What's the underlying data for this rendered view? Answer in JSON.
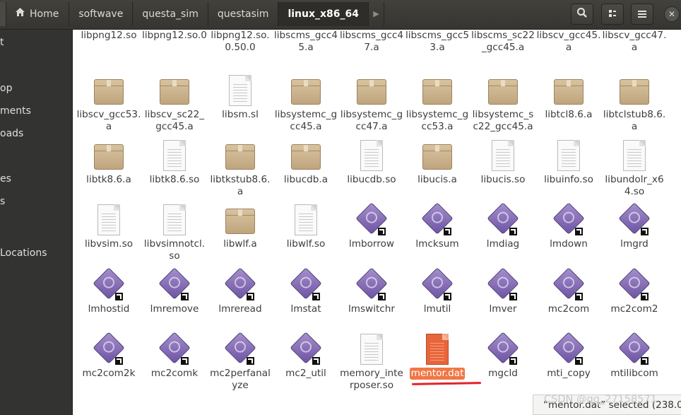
{
  "breadcrumbs": [
    "Home",
    "softwave",
    "questa_sim",
    "questasim",
    "linux_x86_64"
  ],
  "sidebar": [
    "t",
    "op",
    "ments",
    "oads",
    "es",
    "s",
    "Locations"
  ],
  "files": [
    {
      "name": "libpng12.so",
      "icon": "doc"
    },
    {
      "name": "libpng12.so.0",
      "icon": "doc"
    },
    {
      "name": "libpng12.so.0.50.0",
      "icon": "doc"
    },
    {
      "name": "libscms_gcc45.a",
      "icon": "box"
    },
    {
      "name": "libscms_gcc47.a",
      "icon": "box"
    },
    {
      "name": "libscms_gcc53.a",
      "icon": "box"
    },
    {
      "name": "libscms_sc22_gcc45.a",
      "icon": "box"
    },
    {
      "name": "libscv_gcc45.a",
      "icon": "box"
    },
    {
      "name": "libscv_gcc47.a",
      "icon": "box"
    },
    {
      "name": "libscv_gcc53.a",
      "icon": "box"
    },
    {
      "name": "libscv_sc22_gcc45.a",
      "icon": "box"
    },
    {
      "name": "libsm.sl",
      "icon": "doc"
    },
    {
      "name": "libsystemc_gcc45.a",
      "icon": "box"
    },
    {
      "name": "libsystemc_gcc47.a",
      "icon": "box"
    },
    {
      "name": "libsystemc_gcc53.a",
      "icon": "box"
    },
    {
      "name": "libsystemc_sc22_gcc45.a",
      "icon": "box"
    },
    {
      "name": "libtcl8.6.a",
      "icon": "box"
    },
    {
      "name": "libtclstub8.6.a",
      "icon": "box"
    },
    {
      "name": "libtk8.6.a",
      "icon": "box"
    },
    {
      "name": "libtk8.6.so",
      "icon": "doc"
    },
    {
      "name": "libtkstub8.6.a",
      "icon": "box"
    },
    {
      "name": "libucdb.a",
      "icon": "box"
    },
    {
      "name": "libucdb.so",
      "icon": "doc"
    },
    {
      "name": "libucis.a",
      "icon": "box"
    },
    {
      "name": "libucis.so",
      "icon": "doc"
    },
    {
      "name": "libuinfo.so",
      "icon": "doc"
    },
    {
      "name": "libundolr_x64.so",
      "icon": "doc"
    },
    {
      "name": "libvsim.so",
      "icon": "doc"
    },
    {
      "name": "libvsimnotcl.so",
      "icon": "doc"
    },
    {
      "name": "libwlf.a",
      "icon": "box"
    },
    {
      "name": "libwlf.so",
      "icon": "doc"
    },
    {
      "name": "lmborrow",
      "icon": "exe"
    },
    {
      "name": "lmcksum",
      "icon": "exe"
    },
    {
      "name": "lmdiag",
      "icon": "exe"
    },
    {
      "name": "lmdown",
      "icon": "exe"
    },
    {
      "name": "lmgrd",
      "icon": "exe"
    },
    {
      "name": "lmhostid",
      "icon": "exe"
    },
    {
      "name": "lmremove",
      "icon": "exe"
    },
    {
      "name": "lmreread",
      "icon": "exe"
    },
    {
      "name": "lmstat",
      "icon": "exe"
    },
    {
      "name": "lmswitchr",
      "icon": "exe"
    },
    {
      "name": "lmutil",
      "icon": "exe"
    },
    {
      "name": "lmver",
      "icon": "exe"
    },
    {
      "name": "mc2com",
      "icon": "exe"
    },
    {
      "name": "mc2com2",
      "icon": "exe"
    },
    {
      "name": "mc2com2k",
      "icon": "exe"
    },
    {
      "name": "mc2comk",
      "icon": "exe"
    },
    {
      "name": "mc2perfanalyze",
      "icon": "exe"
    },
    {
      "name": "mc2_util",
      "icon": "exe"
    },
    {
      "name": "memory_interposer.so",
      "icon": "doc"
    },
    {
      "name": "mentor.dat",
      "icon": "red",
      "selected": true
    },
    {
      "name": "mgcld",
      "icon": "exe"
    },
    {
      "name": "mti_copy",
      "icon": "exe"
    },
    {
      "name": "mtilibcom",
      "icon": "exe"
    }
  ],
  "status": "“mentor.dat” selected (238.0",
  "watermark": "CSDN @qq_27158571",
  "icons": {
    "home": "home-icon",
    "search": "search-icon",
    "view": "view-grid-icon",
    "menu": "hamburger-menu-icon",
    "close": "close-icon"
  }
}
